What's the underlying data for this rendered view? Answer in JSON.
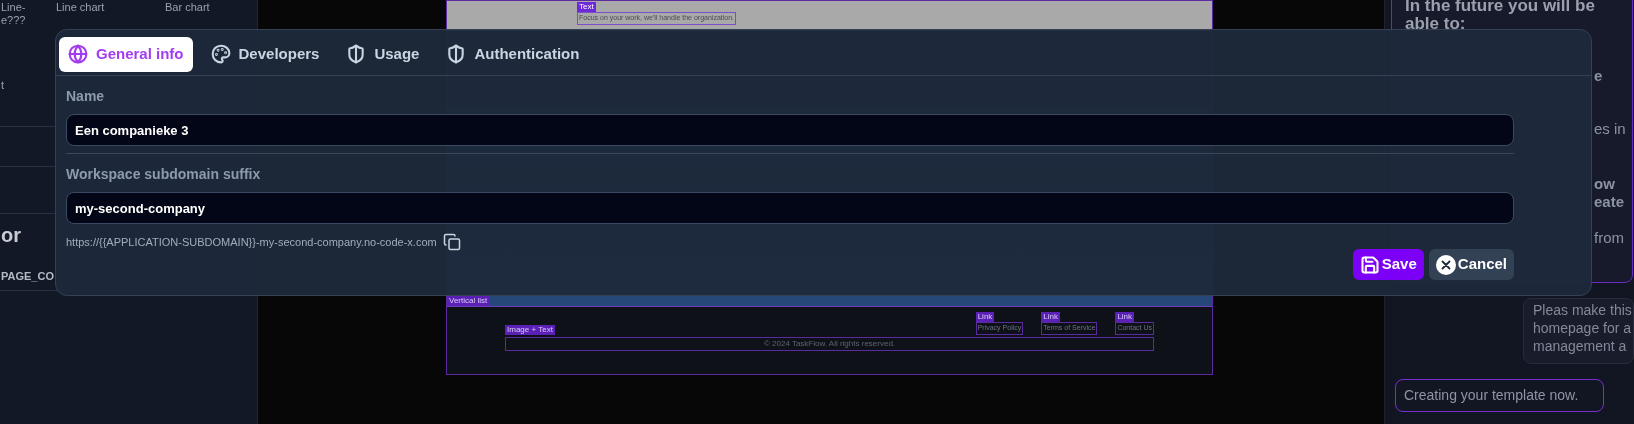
{
  "sidebar": {
    "chart_types": [
      [
        "Line-",
        "e???"
      ],
      [
        "Line chart"
      ],
      [
        "Bar chart"
      ]
    ],
    "fragment": "t",
    "heading": "or",
    "variable": "PAGE_CO"
  },
  "preview": {
    "top_tag": "Text",
    "tagline": "Focus on your work, we'll handle the organization.",
    "footer": {
      "section_tag": "Vertical list",
      "brand_tag": "Image + Text",
      "links": [
        {
          "tag": "Link",
          "label": "Privacy Policy"
        },
        {
          "tag": "Link",
          "label": "Terms of Service"
        },
        {
          "tag": "Link",
          "label": "Contact Us"
        }
      ],
      "copyright": "© 2024 TaskFlow. All rights reserved."
    }
  },
  "chat": {
    "card": {
      "heading": "In the future you will be able to:",
      "fragments": [
        {
          "text": "e",
          "bold": true
        },
        {
          "text": "es in",
          "bold": false
        },
        {
          "text": "ow",
          "bold": true
        },
        {
          "text": "eate",
          "bold": true
        },
        {
          "text": "from",
          "bold": false
        }
      ]
    },
    "user_message": [
      "Pleas make this",
      "homepage for a",
      "management a"
    ],
    "status": "Creating your template now."
  },
  "dialog": {
    "tabs": [
      {
        "label": "General info",
        "kind": "globe",
        "selected": true
      },
      {
        "label": "Developers",
        "kind": "palette",
        "selected": false
      },
      {
        "label": "Usage",
        "kind": "shield",
        "selected": false
      },
      {
        "label": "Authentication",
        "kind": "shield",
        "selected": false
      }
    ],
    "fields": [
      {
        "label": "Name",
        "value": "Een companieke 3"
      },
      {
        "label": "Workspace subdomain suffix",
        "value": "my-second-company"
      }
    ],
    "url": "https://{{APPLICATION-SUBDOMAIN}}-my-second-company.no-code-x.com",
    "buttons": [
      {
        "kind": "save",
        "label": "Save"
      },
      {
        "kind": "cancel",
        "label": "Cancel"
      }
    ]
  }
}
